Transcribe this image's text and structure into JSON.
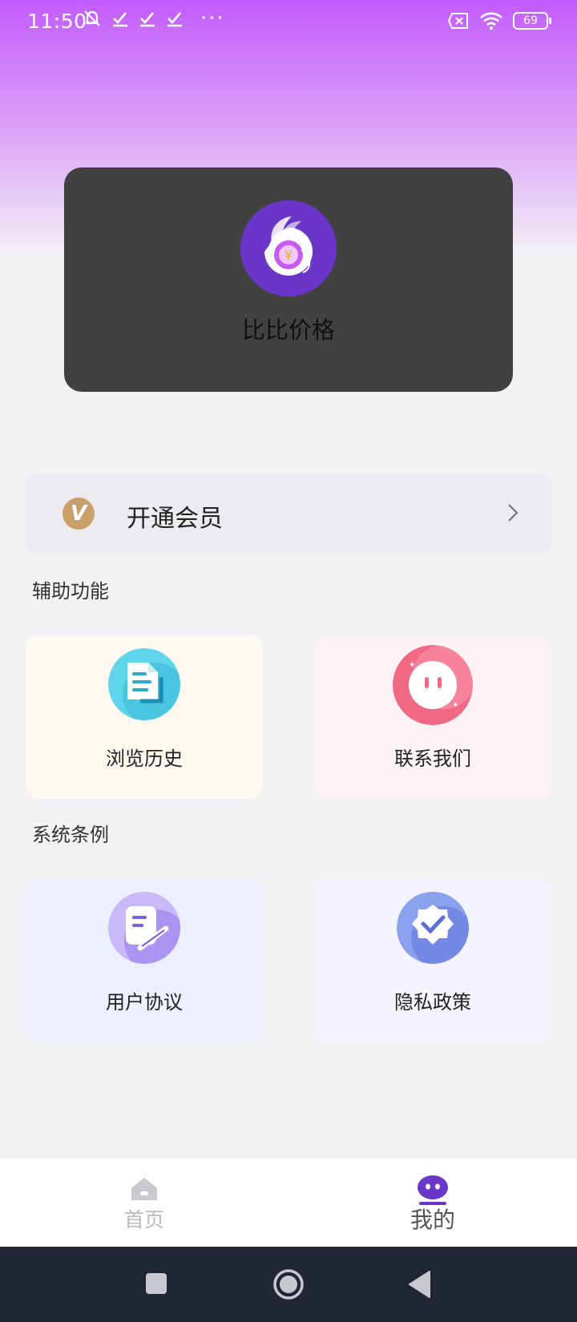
{
  "status_bar": {
    "time": "11:50",
    "more": "···",
    "battery": "69"
  },
  "profile": {
    "app_name": "比比价格"
  },
  "membership": {
    "badge": "V",
    "label": "开通会员"
  },
  "assist": {
    "title": "辅助功能",
    "items": [
      {
        "label": "浏览历史",
        "icon": "document-icon"
      },
      {
        "label": "联系我们",
        "icon": "chat-face-icon"
      }
    ]
  },
  "system": {
    "title": "系统条例",
    "items": [
      {
        "label": "用户协议",
        "icon": "agreement-icon"
      },
      {
        "label": "隐私政策",
        "icon": "shield-check-icon"
      }
    ]
  },
  "bottom_nav": {
    "home": "首页",
    "mine": "我的",
    "active": "mine"
  },
  "colors": {
    "accent": "#6a36c8",
    "gradient_top": "#c25cfb",
    "card_bg": "#414141",
    "vip_gold": "#c9a06a"
  }
}
